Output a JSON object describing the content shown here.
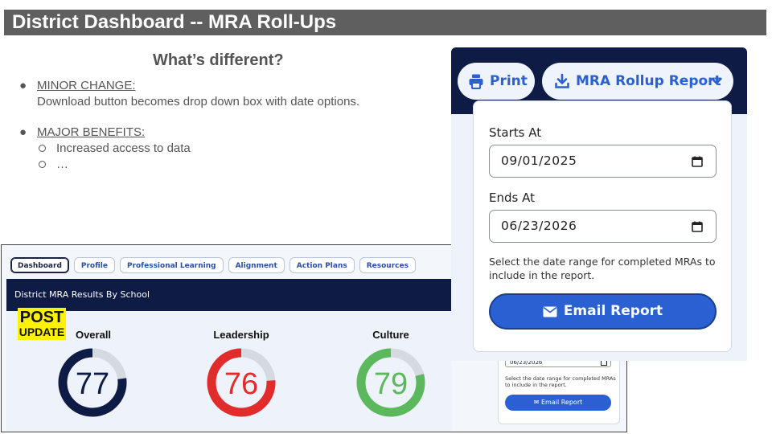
{
  "slide": {
    "title": "District Dashboard -- MRA Roll-Ups",
    "subtitle": "What’s different?",
    "bullets": {
      "minor_label": "MINOR CHANGE:",
      "minor_text": "Download button becomes drop down box with date options.",
      "major_label": "MAJOR BENEFITS:",
      "sub1": "Increased access to data",
      "sub2": "…"
    }
  },
  "dashboard": {
    "tabs": [
      "Dashboard",
      "Profile",
      "Professional Learning",
      "Alignment",
      "Action Plans",
      "Resources"
    ],
    "active_tab": "Dashboard",
    "results_title": "District MRA Results By School",
    "post_tag": {
      "line1": "POST",
      "line2": "UPDATE"
    },
    "gauges": [
      {
        "label": "Overall",
        "value": 77,
        "color": "#0d1b45"
      },
      {
        "label": "Leadership",
        "value": 76,
        "color": "#e22b2b"
      },
      {
        "label": "Culture",
        "value": 79,
        "color": "#5cb85c"
      }
    ],
    "mini_popover": {
      "date": "06/23/2026",
      "help": "Select the date range for completed MRAs to include in the report.",
      "button": "Email Report"
    }
  },
  "overlay": {
    "print_label": "Print",
    "mra_label": "MRA Rollup Report",
    "starts_label": "Starts At",
    "starts_value": "09/01/2025",
    "ends_label": "Ends At",
    "ends_value": "06/23/2026",
    "help": "Select the date range for completed MRAs to include in the report.",
    "email_button": "Email Report",
    "icons": [
      "printer-icon",
      "download-icon",
      "chevron-down-icon",
      "calendar-icon",
      "envelope-icon"
    ],
    "colors": {
      "navy": "#0d1b45",
      "accent": "#2a60d1"
    }
  }
}
